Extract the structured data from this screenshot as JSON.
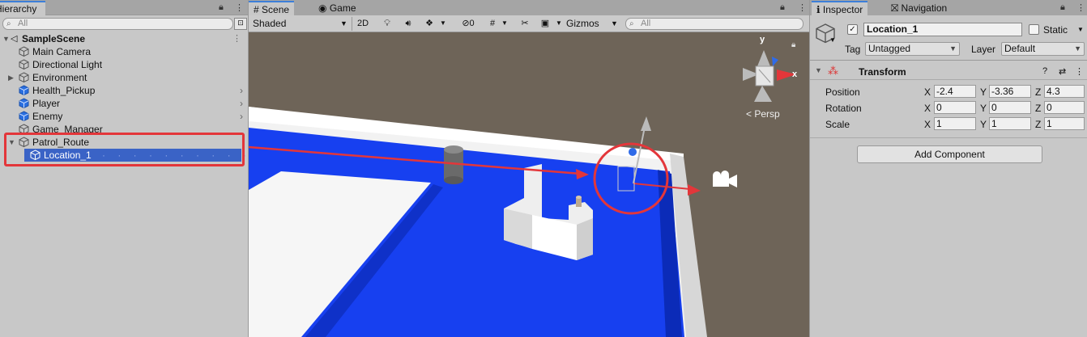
{
  "hierarchy": {
    "tab_label": "Hierarchy",
    "search_placeholder": "All",
    "scene_name": "SampleScene",
    "items": [
      {
        "label": "Main Camera"
      },
      {
        "label": "Directional Light"
      },
      {
        "label": "Environment"
      },
      {
        "label": "Health_Pickup"
      },
      {
        "label": "Player"
      },
      {
        "label": "Enemy"
      },
      {
        "label": "Game_Manager"
      },
      {
        "label": "Patrol_Route"
      },
      {
        "label": "Location_1"
      }
    ]
  },
  "scene": {
    "tabs": [
      {
        "label": "Scene"
      },
      {
        "label": "Game"
      }
    ],
    "shading_mode": "Shaded",
    "toggle_2d": "2D",
    "hidden_count": "0",
    "gizmos_label": "Gizmos",
    "search_placeholder": "All",
    "persp_label": "< Persp",
    "axis_y": "y",
    "axis_x": "x",
    "colors": {
      "ground": "#6e6458",
      "floor_blue": "#1740f0",
      "highlight_red": "#e3363a"
    }
  },
  "inspector": {
    "tabs": [
      {
        "label": "Inspector"
      },
      {
        "label": "Navigation"
      }
    ],
    "object_name": "Location_1",
    "static_label": "Static",
    "tag_label": "Tag",
    "tag_value": "Untagged",
    "layer_label": "Layer",
    "layer_value": "Default",
    "component_title": "Transform",
    "rows": [
      {
        "label": "Position",
        "x": "-2.4",
        "y": "-3.36",
        "z": "4.3"
      },
      {
        "label": "Rotation",
        "x": "0",
        "y": "0",
        "z": "0"
      },
      {
        "label": "Scale",
        "x": "1",
        "y": "1",
        "z": "1"
      }
    ],
    "axis_labels": {
      "x": "X",
      "y": "Y",
      "z": "Z"
    },
    "add_component_label": "Add Component"
  }
}
